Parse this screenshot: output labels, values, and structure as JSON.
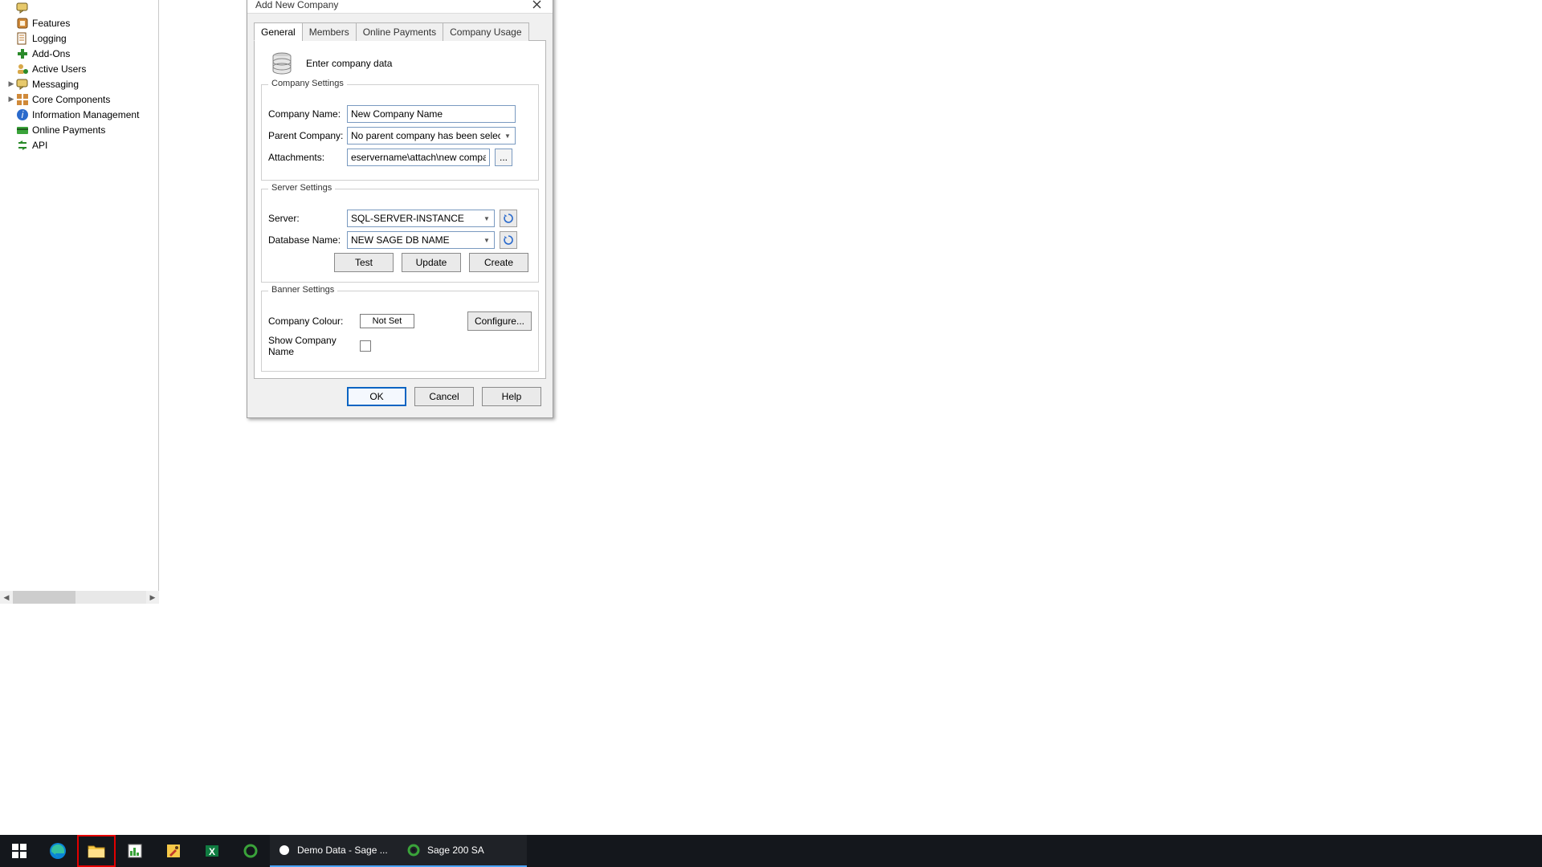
{
  "tree": {
    "items": [
      {
        "label": "",
        "icon": "chat-bubble",
        "expander": false
      },
      {
        "label": "Features",
        "icon": "feature",
        "expander": false
      },
      {
        "label": "Logging",
        "icon": "log",
        "expander": false
      },
      {
        "label": "Add-Ons",
        "icon": "plus-green",
        "expander": false
      },
      {
        "label": "Active Users",
        "icon": "users-active",
        "expander": false
      },
      {
        "label": "Messaging",
        "icon": "chat-bubble",
        "expander": true
      },
      {
        "label": "Core Components",
        "icon": "components",
        "expander": true
      },
      {
        "label": "Information Management",
        "icon": "info-blue",
        "expander": false
      },
      {
        "label": "Online Payments",
        "icon": "card-green",
        "expander": false
      },
      {
        "label": "API",
        "icon": "api-arrows",
        "expander": false
      }
    ]
  },
  "dialog": {
    "title": "Add New Company",
    "tabs": [
      "General",
      "Members",
      "Online Payments",
      "Company Usage"
    ],
    "active_tab": 0,
    "intro": "Enter company data",
    "company_settings": {
      "legend": "Company Settings",
      "labels": {
        "name": "Company Name:",
        "parent": "Parent Company:",
        "attach": "Attachments:"
      },
      "name_value": "New Company Name",
      "parent_value": "No parent company has been selecte",
      "attach_value": "eservername\\attach\\new company",
      "browse_label": "..."
    },
    "server_settings": {
      "legend": "Server Settings",
      "labels": {
        "server": "Server:",
        "db": "Database Name:"
      },
      "server_value": "SQL-SERVER-INSTANCE",
      "db_value": "NEW SAGE DB NAME",
      "buttons": {
        "test": "Test",
        "update": "Update",
        "create": "Create"
      }
    },
    "banner_settings": {
      "legend": "Banner Settings",
      "labels": {
        "colour": "Company Colour:",
        "show": "Show Company Name"
      },
      "colour_value": "Not Set",
      "configure_label": "Configure...",
      "show_checked": false
    },
    "footer": {
      "ok": "OK",
      "cancel": "Cancel",
      "help": "Help"
    }
  },
  "taskbar": {
    "apps": [
      {
        "label": "Demo Data - Sage ...",
        "icon": "circle-white",
        "running": true
      },
      {
        "label": "Sage 200 SA",
        "icon": "gear-green",
        "running": true
      }
    ]
  }
}
